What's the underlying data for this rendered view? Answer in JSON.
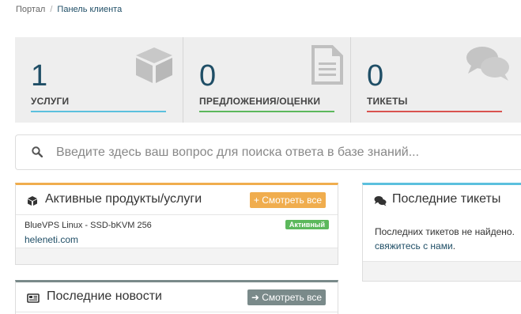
{
  "breadcrumb": {
    "portal": "Портал",
    "separator": "/",
    "current": "Панель клиента"
  },
  "tiles": [
    {
      "count": "1",
      "label": "УСЛУГИ",
      "icon": "cube-icon",
      "accent": "#5bc0de"
    },
    {
      "count": "0",
      "label": "ПРЕДЛОЖЕНИЯ/ОЦЕНКИ",
      "icon": "file-text-icon",
      "accent": "#5cb85c"
    },
    {
      "count": "0",
      "label": "ТИКЕТЫ",
      "icon": "comments-icon",
      "accent": "#d9534f"
    }
  ],
  "search": {
    "placeholder": "Введите здесь ваш вопрос для поиска ответа в базе знаний..."
  },
  "products_panel": {
    "title": "Активные продукты/услуги",
    "view_all": "+ Смотреть все",
    "items": [
      {
        "name": "BlueVPS Linux - SSD-bKVM 256",
        "domain": "heleneti.com",
        "status": "Активный"
      }
    ]
  },
  "news_panel": {
    "title": "Последние новости",
    "view_all": "➜ Смотреть все"
  },
  "tickets_panel": {
    "title": "Последние тикеты",
    "text": "Последних тикетов не найдено.",
    "link": "свяжитесь с нами",
    "link_suffix": "."
  },
  "colors": {
    "primary": "#1f4e66",
    "orange": "#f0ad4e",
    "green": "#5cb85c",
    "red": "#d9534f",
    "info": "#5bc0de"
  }
}
